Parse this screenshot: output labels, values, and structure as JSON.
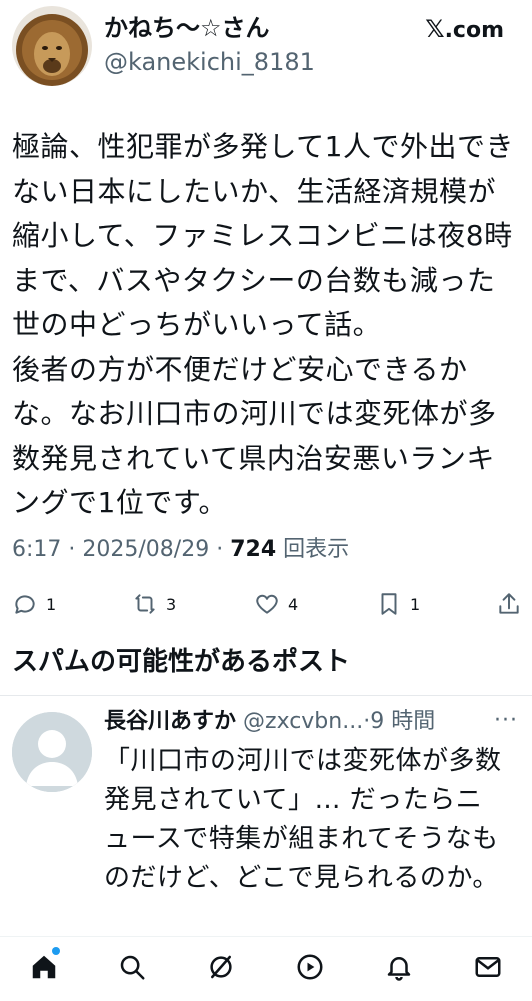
{
  "post": {
    "author": {
      "display_name": "かねち〜☆さん",
      "handle": "@kanekichi_8181"
    },
    "brand": {
      "logo": "𝕏",
      "label": ".com"
    },
    "body": [
      "極論、性犯罪が多発して1人で外出できない日本にしたいか、生活経済規模が縮小して、ファミレスコンビニは夜8時まで、バスやタクシーの台数も減った世の中どっちがいいって話。",
      "後者の方が不便だけど安心できるかな。なお川口市の河川では変死体が多数発見されていて県内治安悪いランキングで1位です。"
    ],
    "meta": {
      "time": "6:17",
      "separator": "·",
      "date": "2025/08/29",
      "views_count": "724",
      "views_label": "回表示"
    },
    "actions": {
      "reply_count": "1",
      "repost_count": "3",
      "like_count": "4",
      "bookmark_count": "1"
    }
  },
  "spam_section": {
    "heading": "スパムの可能性があるポスト"
  },
  "reply": {
    "display_name": "長谷川あすか",
    "handle": "@zxcvbn...",
    "separator": "·",
    "time": "9 時間",
    "more": "···",
    "body": "「川口市の河川では変死体が多数発見されていて」… だったらニュースで特集が組まれてそうなものだけど、どこで見られるのか。"
  },
  "tabbar": {
    "items": [
      "home-icon",
      "search-icon",
      "grok-icon",
      "video-icon",
      "notifications-icon",
      "messages-icon"
    ]
  },
  "colors": {
    "text": "#0f1419",
    "secondary": "#536471",
    "accent": "#1d9bf0",
    "divider": "#e6e9ec"
  }
}
